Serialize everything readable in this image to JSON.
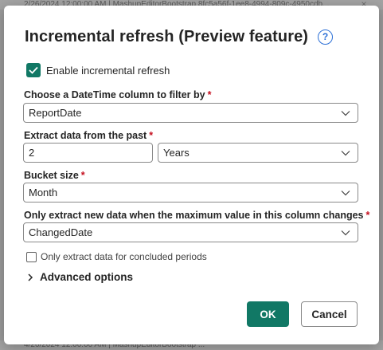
{
  "background": {
    "top_row_text": "2/26/2024  12:00:00 AM | MashupEditorBootstrap   8fc5a56f-1ee8-4994-809c-4950cdb...",
    "bottom_row_text": "4/26/2024  12:00:00 AM | MashupEditorBootstrap   ...",
    "close_glyph": "×"
  },
  "dialog": {
    "title": "Incremental refresh (Preview feature)",
    "help_icon_glyph": "?",
    "enable_checkbox": {
      "label": "Enable incremental refresh",
      "checked": true
    },
    "datetime_column": {
      "label": "Choose a DateTime column to filter by",
      "required_mark": "*",
      "value": "ReportDate"
    },
    "extract_past": {
      "label": "Extract data from the past",
      "required_mark": "*",
      "amount": "2",
      "unit": "Years"
    },
    "bucket_size": {
      "label": "Bucket size",
      "required_mark": "*",
      "value": "Month"
    },
    "change_column": {
      "label": "Only extract new data when the maximum value in this column changes",
      "required_mark": "*",
      "value": "ChangedDate"
    },
    "concluded_checkbox": {
      "label": "Only extract data for concluded periods",
      "checked": false
    },
    "advanced_options": {
      "label": "Advanced options",
      "icon": "chevron-right-icon"
    },
    "buttons": {
      "ok": "OK",
      "cancel": "Cancel"
    }
  },
  "colors": {
    "primary": "#117865",
    "help_icon": "#2b6fd6",
    "required": "#c50f1f",
    "overlay": "#9b9b9b"
  }
}
